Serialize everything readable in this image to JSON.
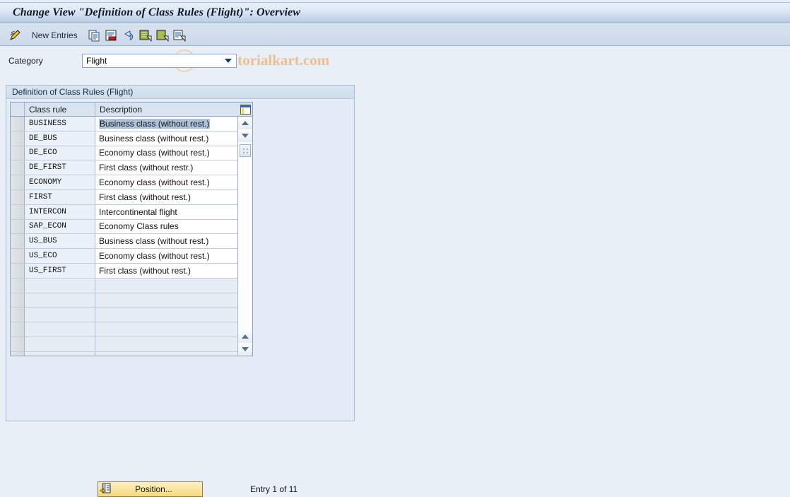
{
  "window": {
    "title": "Change View \"Definition of Class Rules (Flight)\": Overview"
  },
  "toolbar": {
    "new_entries_label": "New Entries",
    "icons": [
      {
        "name": "change-display-pencil-icon",
        "glyph": "pencil"
      },
      {
        "name": "copy-icon",
        "glyph": "copy"
      },
      {
        "name": "delete-icon",
        "glyph": "delete"
      },
      {
        "name": "undo-icon",
        "glyph": "undo"
      },
      {
        "name": "select-all-icon",
        "glyph": "select-all"
      },
      {
        "name": "deselect-all-icon",
        "glyph": "deselect-all"
      },
      {
        "name": "select-block-icon",
        "glyph": "select-block"
      }
    ]
  },
  "watermark": {
    "text": "www.tutorialkart.com",
    "color": "#edbe8e"
  },
  "category": {
    "label": "Category",
    "value": "Flight"
  },
  "panel": {
    "header": "Definition of Class Rules (Flight)"
  },
  "table": {
    "columns": [
      "Class rule",
      "Description"
    ],
    "settings_icon": "table-settings-icon",
    "rows": [
      {
        "rule": "BUSINESS",
        "description": "Business class (without rest.)",
        "selected": true
      },
      {
        "rule": "DE_BUS",
        "description": "Business class (without rest.)",
        "selected": false
      },
      {
        "rule": "DE_ECO",
        "description": "Economy class (without rest.)",
        "selected": false
      },
      {
        "rule": "DE_FIRST",
        "description": "First class (without restr.)",
        "selected": false
      },
      {
        "rule": "ECONOMY",
        "description": "Economy class (without rest.)",
        "selected": false
      },
      {
        "rule": "FIRST",
        "description": "First class (without rest.)",
        "selected": false
      },
      {
        "rule": "INTERCON",
        "description": "Intercontinental flight",
        "selected": false
      },
      {
        "rule": "SAP_ECON",
        "description": "Economy Class rules",
        "selected": false
      },
      {
        "rule": "US_BUS",
        "description": "Business class (without rest.)",
        "selected": false
      },
      {
        "rule": "US_ECO",
        "description": "Economy class (without rest.)",
        "selected": false
      },
      {
        "rule": "US_FIRST",
        "description": "First class (without rest.)",
        "selected": false
      },
      {
        "rule": "",
        "description": "",
        "selected": false
      },
      {
        "rule": "",
        "description": "",
        "selected": false
      },
      {
        "rule": "",
        "description": "",
        "selected": false
      },
      {
        "rule": "",
        "description": "",
        "selected": false
      },
      {
        "rule": "",
        "description": "",
        "selected": false
      },
      {
        "rule": "",
        "description": "",
        "selected": false
      }
    ]
  },
  "footer": {
    "position_button": "Position...",
    "entry_count": "Entry 1 of 11"
  }
}
